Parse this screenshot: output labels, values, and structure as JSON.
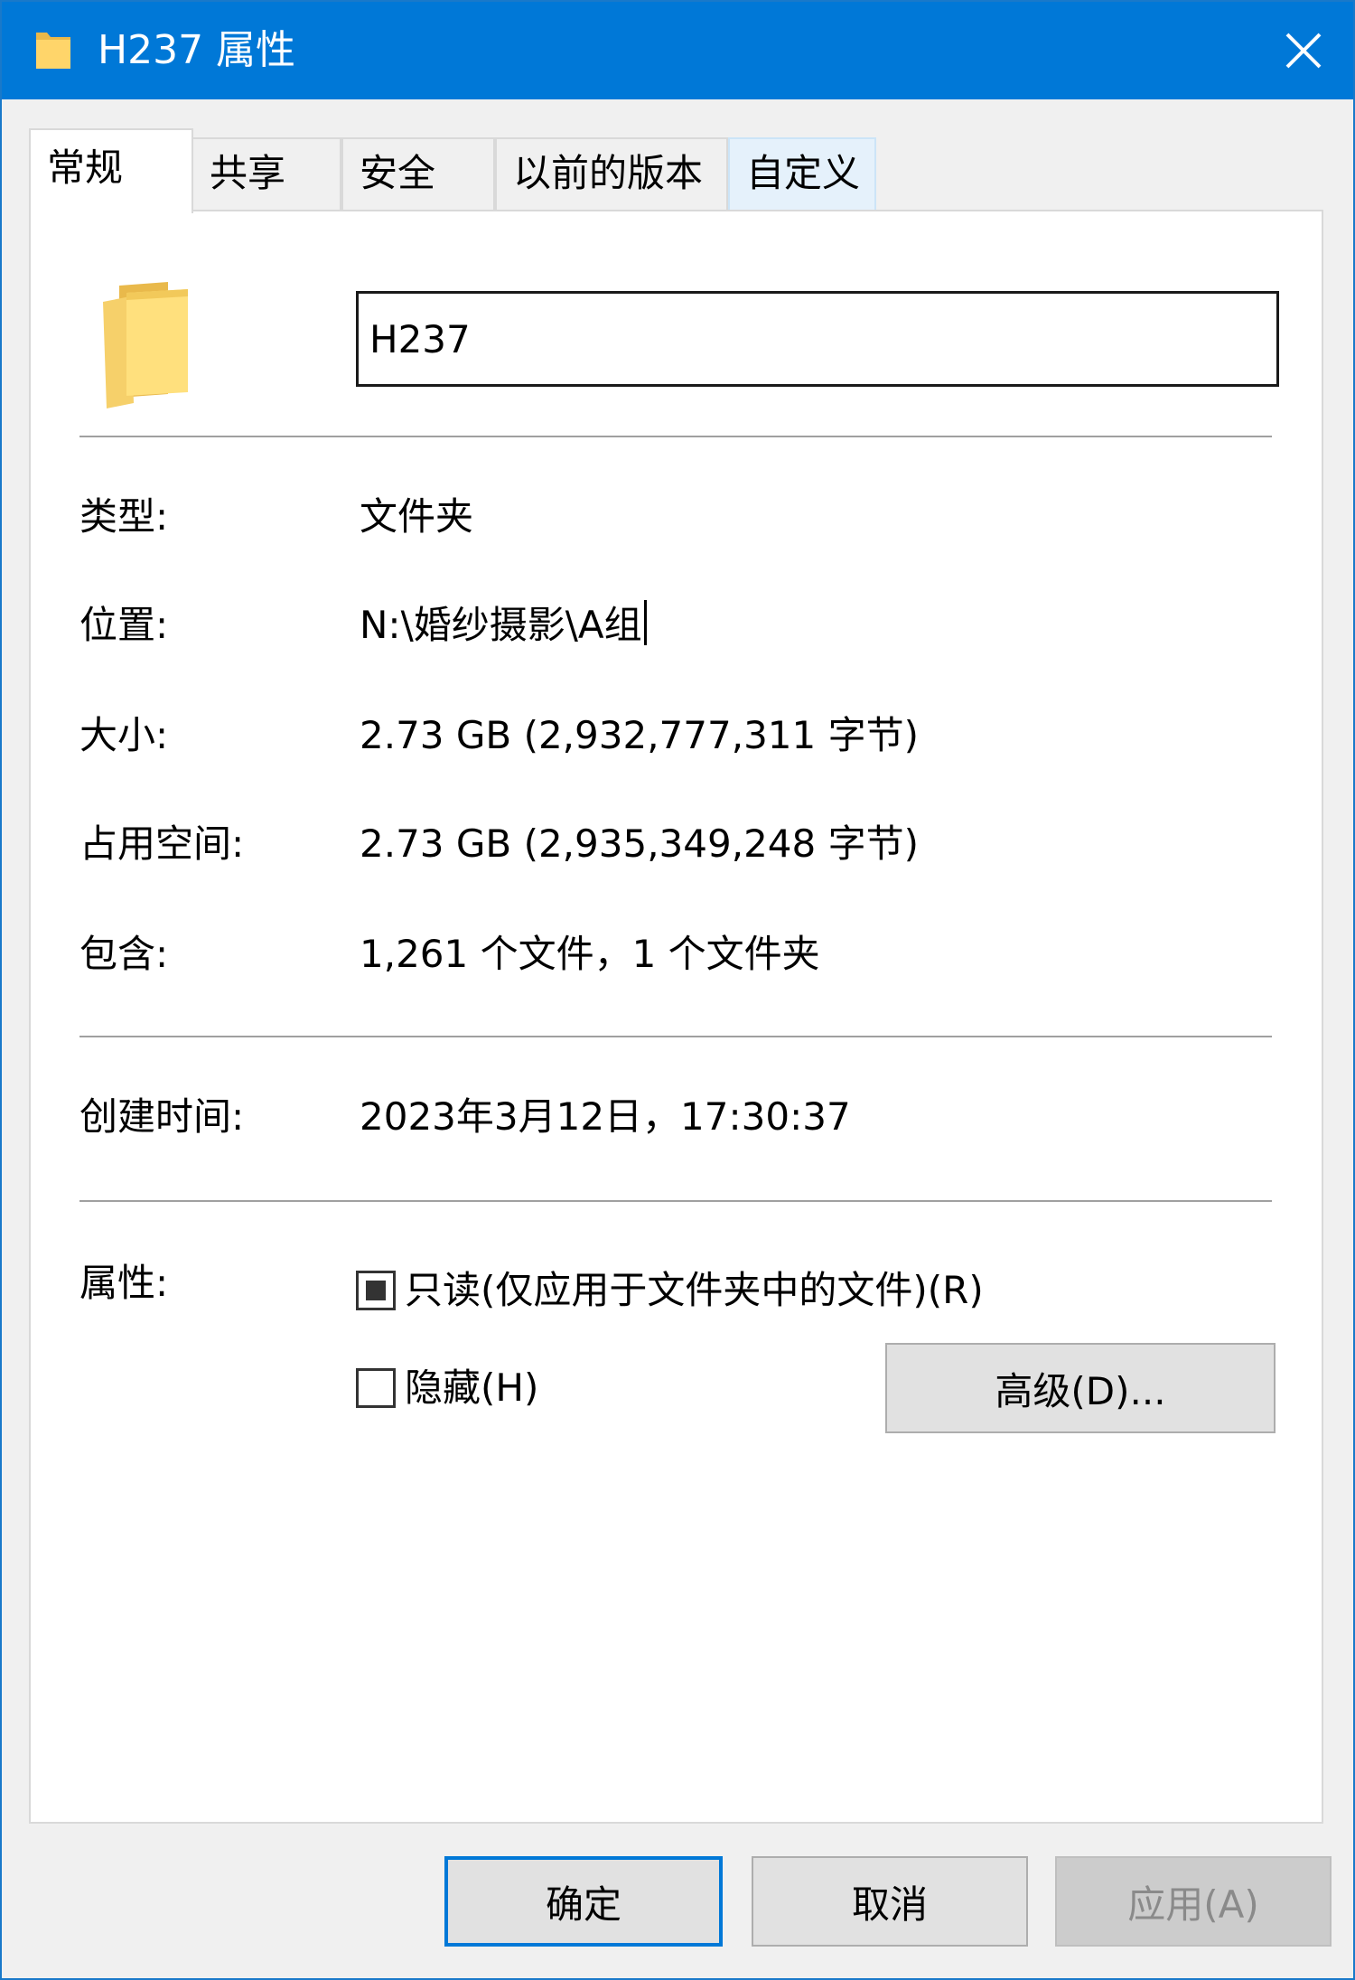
{
  "window": {
    "title": "H237 属性",
    "accent_color": "#0078d7",
    "icon": "folder-icon",
    "close_icon": "close-icon"
  },
  "tabs": [
    {
      "label": "常规",
      "active": true
    },
    {
      "label": "共享"
    },
    {
      "label": "安全"
    },
    {
      "label": "以前的版本"
    },
    {
      "label": "自定义",
      "hovered": true
    }
  ],
  "general": {
    "folder_name": "H237",
    "rows": {
      "type": {
        "label": "类型:",
        "value": "文件夹"
      },
      "location": {
        "label": "位置:",
        "value": "N:\\婚纱摄影\\A组"
      },
      "size": {
        "label": "大小:",
        "value": "2.73 GB (2,932,777,311 字节)"
      },
      "size_on_disk": {
        "label": "占用空间:",
        "value": "2.73 GB (2,935,349,248 字节)"
      },
      "contains": {
        "label": "包含:",
        "value": "1,261 个文件，1 个文件夹"
      },
      "created": {
        "label": "创建时间:",
        "value": "2023年3月12日，17:30:37"
      }
    },
    "attributes": {
      "label": "属性:",
      "readonly": {
        "label": "只读(仅应用于文件夹中的文件)(R)",
        "state": "indeterminate"
      },
      "hidden": {
        "label": "隐藏(H)",
        "checked": false
      },
      "advanced_button": "高级(D)..."
    }
  },
  "footer": {
    "ok": "确定",
    "cancel": "取消",
    "apply": "应用(A)",
    "apply_enabled": false
  }
}
